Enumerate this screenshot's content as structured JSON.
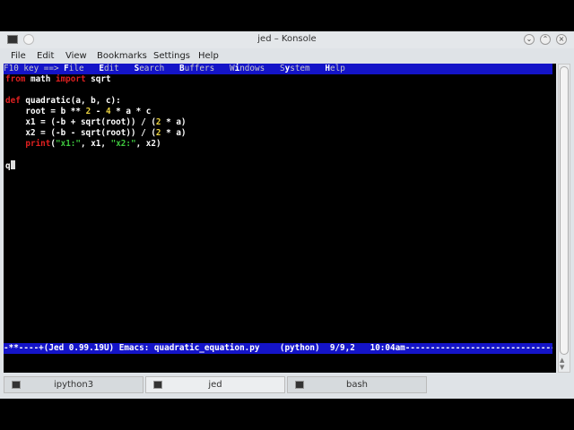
{
  "window": {
    "title": "jed – Konsole"
  },
  "menubar": [
    "File",
    "Edit",
    "View",
    "Bookmarks",
    "Settings",
    "Help"
  ],
  "jed_menu": {
    "prefix": "F10 key ==> ",
    "items": [
      {
        "hot": "F",
        "rest": "ile"
      },
      {
        "hot": "E",
        "rest": "dit"
      },
      {
        "hot": "S",
        "rest": "earch"
      },
      {
        "hot": "B",
        "rest": "uffers"
      },
      {
        "pre": "W",
        "hot": "i",
        "rest": "ndows"
      },
      {
        "pre": "S",
        "hot": "y",
        "rest": "stem"
      },
      {
        "hot": "H",
        "rest": "elp"
      }
    ]
  },
  "code": {
    "l1": [
      "from",
      " math ",
      "import",
      " sqrt"
    ],
    "l3": [
      "def",
      " quadratic(a, b, c):"
    ],
    "l4": [
      "    root = b ** ",
      "2",
      " - ",
      "4",
      " * a * c"
    ],
    "l5": [
      "    x1 = (-b + sqrt(root)) / (",
      "2",
      " * a)"
    ],
    "l6": [
      "    x2 = (-b - sqrt(root)) / (",
      "2",
      " * a)"
    ],
    "l7": [
      "    ",
      "print",
      "(",
      "\"x1:\"",
      ", x1, ",
      "\"x2:\"",
      ", x2)"
    ],
    "l9": "q"
  },
  "status_line": "-**----+(Jed 0.99.19U) Emacs: quadratic_equation.py    (python)  9/9,2   10:04am---------------------------------",
  "tabs": [
    "ipython3",
    "jed",
    "bash"
  ],
  "colors": {
    "status_bar": "#1414c8",
    "keyword": "#e02020",
    "number": "#e8d040",
    "string": "#3ec83e"
  }
}
